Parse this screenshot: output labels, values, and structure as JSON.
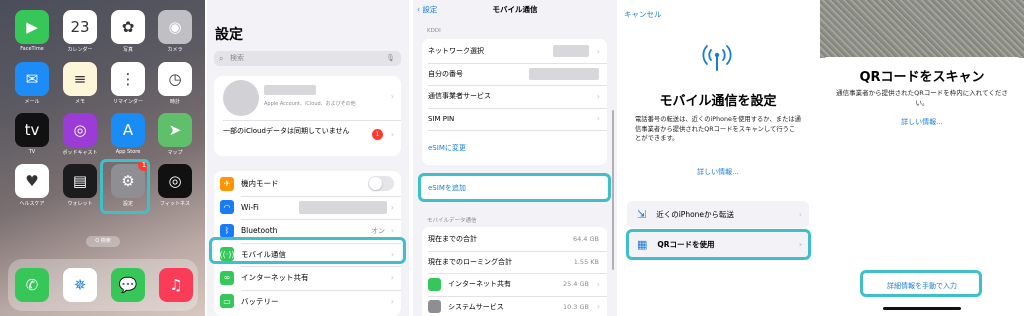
{
  "home": {
    "apps": [
      {
        "label": "FaceTime",
        "icon": "facetime-icon",
        "color": "#37c759",
        "glyph": "▶"
      },
      {
        "label": "カレンダー",
        "icon": "calendar-icon",
        "color": "#ffffff",
        "glyph": "23",
        "sub": "月"
      },
      {
        "label": "写真",
        "icon": "photos-icon",
        "color": "#ffffff",
        "glyph": "✿"
      },
      {
        "label": "カメラ",
        "icon": "camera-icon",
        "color": "#bfbfc4",
        "glyph": "◉"
      },
      {
        "label": "メール",
        "icon": "mail-icon",
        "color": "#1e8cf7",
        "glyph": "✉"
      },
      {
        "label": "メモ",
        "icon": "notes-icon",
        "color": "#fdf6d8",
        "glyph": "≡"
      },
      {
        "label": "リマインダー",
        "icon": "reminders-icon",
        "color": "#ffffff",
        "glyph": "⋮"
      },
      {
        "label": "時計",
        "icon": "clock-icon",
        "color": "#ffffff",
        "glyph": "◷"
      },
      {
        "label": "TV",
        "icon": "tv-icon",
        "color": "#111111",
        "glyph": "tv"
      },
      {
        "label": "ポッドキャスト",
        "icon": "podcasts-icon",
        "color": "#9b3cd6",
        "glyph": "◎"
      },
      {
        "label": "App Store",
        "icon": "appstore-icon",
        "color": "#1a8cf5",
        "glyph": "A"
      },
      {
        "label": "マップ",
        "icon": "maps-icon",
        "color": "#5fbf6a",
        "glyph": "➤"
      },
      {
        "label": "ヘルスケア",
        "icon": "health-icon",
        "color": "#ffffff",
        "glyph": "♥"
      },
      {
        "label": "ウォレット",
        "icon": "wallet-icon",
        "color": "#1c1c1e",
        "glyph": "▤"
      },
      {
        "label": "設定",
        "icon": "settings-icon",
        "color": "#8e8e93",
        "glyph": "⚙",
        "badge": "1"
      },
      {
        "label": "フィットネス",
        "icon": "fitness-icon",
        "color": "#111111",
        "glyph": "◎"
      }
    ],
    "search_label": "Q 検索",
    "dock": [
      {
        "icon": "phone-icon",
        "color": "#37c759",
        "glyph": "✆"
      },
      {
        "icon": "safari-icon",
        "color": "#ffffff",
        "glyph": "✵"
      },
      {
        "icon": "messages-icon",
        "color": "#37c759",
        "glyph": "💬"
      },
      {
        "icon": "music-icon",
        "color": "#fb3c58",
        "glyph": "♫"
      }
    ]
  },
  "settings": {
    "title": "設定",
    "search_placeholder": "検索",
    "account_sub": "Apple Account、iCloud、およびその他",
    "icloud_notice": "一部のiCloudデータは同期していません",
    "icloud_badge": "1",
    "rows": [
      {
        "label": "機内モード",
        "icon": "airplane-icon",
        "color": "#ff9500",
        "glyph": "✈"
      },
      {
        "label": "Wi-Fi",
        "icon": "wifi-icon",
        "color": "#1a7bf6",
        "glyph": "◠"
      },
      {
        "label": "Bluetooth",
        "icon": "bluetooth-icon",
        "color": "#1a7bf6",
        "glyph": "ᛒ",
        "value": "オン"
      },
      {
        "label": "モバイル通信",
        "icon": "cellular-icon",
        "color": "#34c759",
        "glyph": "((·))"
      },
      {
        "label": "インターネット共有",
        "icon": "hotspot-icon",
        "color": "#34c759",
        "glyph": "∞"
      },
      {
        "label": "バッテリー",
        "icon": "battery-icon",
        "color": "#34c759",
        "glyph": "▭"
      }
    ]
  },
  "mobile": {
    "back_label": "設定",
    "title": "モバイル通信",
    "carrier_header": "KDDI",
    "carrier_rows": [
      {
        "label": "ネットワーク選択"
      },
      {
        "label": "自分の番号"
      },
      {
        "label": "通信事業者サービス"
      },
      {
        "label": "SIM PIN"
      }
    ],
    "esim_change": "eSIMに変更",
    "esim_add": "eSIMを追加",
    "data_header": "モバイルデータ通信",
    "usage_rows": [
      {
        "label": "現在までの合計",
        "value": "64.4 GB"
      },
      {
        "label": "現在までのローミング合計",
        "value": "1.55 KB"
      },
      {
        "label": "インターネット共有",
        "value": "25.4 GB",
        "icon": "hotspot-icon",
        "color": "#34c759"
      },
      {
        "label": "システムサービス",
        "value": "10.3 GB",
        "icon": "system-gear-icon",
        "color": "#8e8e93"
      }
    ]
  },
  "setup": {
    "cancel_label": "キャンセル",
    "title": "モバイル通信を設定",
    "body": "電話番号の転送は、近くのiPhoneを使用するか、または通信事業者から提供されたQRコードをスキャンして行うことができます。",
    "more_info": "詳しい情報...",
    "options": [
      {
        "label": "近くのiPhoneから転送",
        "icon": "transfer-icon"
      },
      {
        "label": "QRコードを使用",
        "icon": "qr-code-icon"
      }
    ]
  },
  "scan": {
    "title": "QRコードをスキャン",
    "body": "通信事業者から提供されたQRコードを枠内に入れてください。",
    "more_info": "詳しい情報...",
    "manual_entry": "詳細情報を手動で入力"
  },
  "accent": "#3fc0c8",
  "link_color": "#1a7bd8"
}
